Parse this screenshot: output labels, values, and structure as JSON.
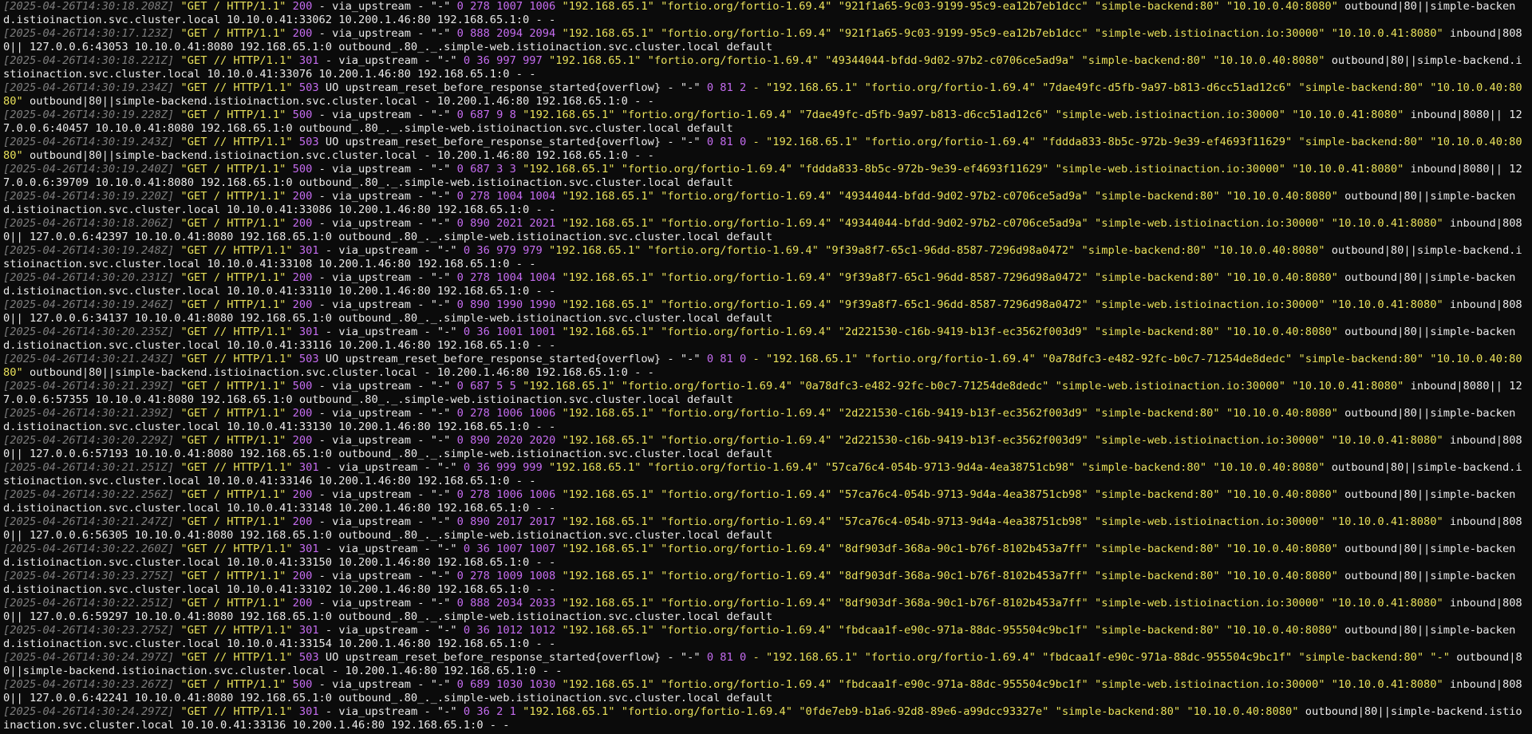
{
  "terminal": {
    "lines": [
      {
        "ts": "[2025-04-26T14:30:18.208Z]",
        "req": "\"GET / HTTP/1.1\"",
        "code": "200",
        "flags": "- via_upstream - \"-\"",
        "nums": "0 278 1007 1006",
        "quoted": "\"192.168.65.1\" \"fortio.org/fortio-1.69.4\" \"921f1a65-9c03-9199-95c9-ea12b7eb1dcc\" \"simple-backend:80\" \"10.10.0.40:8080\"",
        "tail": "outbound|80||simple-backend.istioinaction.svc.cluster.local 10.10.0.41:33062 10.200.1.46:80 192.168.65.1:0 - -"
      },
      {
        "ts": "[2025-04-26T14:30:17.123Z]",
        "req": "\"GET / HTTP/1.1\"",
        "code": "200",
        "flags": "- via_upstream - \"-\"",
        "nums": "0 888 2094 2094",
        "quoted": "\"192.168.65.1\" \"fortio.org/fortio-1.69.4\" \"921f1a65-9c03-9199-95c9-ea12b7eb1dcc\" \"simple-web.istioinaction.io:30000\" \"10.10.0.41:8080\"",
        "tail": "inbound|8080|| 127.0.0.6:43053 10.10.0.41:8080 192.168.65.1:0 outbound_.80_._.simple-web.istioinaction.svc.cluster.local default"
      },
      {
        "ts": "[2025-04-26T14:30:18.221Z]",
        "req": "\"GET // HTTP/1.1\"",
        "code": "301",
        "flags": "- via_upstream - \"-\"",
        "nums": "0 36 997 997",
        "quoted": "\"192.168.65.1\" \"fortio.org/fortio-1.69.4\" \"49344044-bfdd-9d02-97b2-c0706ce5ad9a\" \"simple-backend:80\" \"10.10.0.40:8080\"",
        "tail": "outbound|80||simple-backend.istioinaction.svc.cluster.local 10.10.0.41:33076 10.200.1.46:80 192.168.65.1:0 - -"
      },
      {
        "ts": "[2025-04-26T14:30:19.234Z]",
        "req": "\"GET // HTTP/1.1\"",
        "code": "503",
        "flags": "UO upstream_reset_before_response_started{overflow} - \"-\"",
        "nums": "0 81 2",
        "quoted": "- \"192.168.65.1\" \"fortio.org/fortio-1.69.4\" \"7dae49fc-d5fb-9a97-b813-d6cc51ad12c6\" \"simple-backend:80\" \"10.10.0.40:8080\"",
        "tail": "outbound|80||simple-backend.istioinaction.svc.cluster.local - 10.200.1.46:80 192.168.65.1:0 - -"
      },
      {
        "ts": "[2025-04-26T14:30:19.228Z]",
        "req": "\"GET / HTTP/1.1\"",
        "code": "500",
        "flags": "- via_upstream - \"-\"",
        "nums": "0 687 9 8",
        "quoted": "\"192.168.65.1\" \"fortio.org/fortio-1.69.4\" \"7dae49fc-d5fb-9a97-b813-d6cc51ad12c6\" \"simple-web.istioinaction.io:30000\" \"10.10.0.41:8080\"",
        "tail": "inbound|8080|| 127.0.0.6:40457 10.10.0.41:8080 192.168.65.1:0 outbound_.80_._.simple-web.istioinaction.svc.cluster.local default"
      },
      {
        "ts": "[2025-04-26T14:30:19.243Z]",
        "req": "\"GET // HTTP/1.1\"",
        "code": "503",
        "flags": "UO upstream_reset_before_response_started{overflow} - \"-\"",
        "nums": "0 81 0",
        "quoted": "- \"192.168.65.1\" \"fortio.org/fortio-1.69.4\" \"fddda833-8b5c-972b-9e39-ef4693f11629\" \"simple-backend:80\" \"10.10.0.40:8080\"",
        "tail": "outbound|80||simple-backend.istioinaction.svc.cluster.local - 10.200.1.46:80 192.168.65.1:0 - -"
      },
      {
        "ts": "[2025-04-26T14:30:19.240Z]",
        "req": "\"GET / HTTP/1.1\"",
        "code": "500",
        "flags": "- via_upstream - \"-\"",
        "nums": "0 687 3 3",
        "quoted": "\"192.168.65.1\" \"fortio.org/fortio-1.69.4\" \"fddda833-8b5c-972b-9e39-ef4693f11629\" \"simple-web.istioinaction.io:30000\" \"10.10.0.41:8080\"",
        "tail": "inbound|8080|| 127.0.0.6:39709 10.10.0.41:8080 192.168.65.1:0 outbound_.80_._.simple-web.istioinaction.svc.cluster.local default"
      },
      {
        "ts": "[2025-04-26T14:30:19.220Z]",
        "req": "\"GET / HTTP/1.1\"",
        "code": "200",
        "flags": "- via_upstream - \"-\"",
        "nums": "0 278 1004 1004",
        "quoted": "\"192.168.65.1\" \"fortio.org/fortio-1.69.4\" \"49344044-bfdd-9d02-97b2-c0706ce5ad9a\" \"simple-backend:80\" \"10.10.0.40:8080\"",
        "tail": "outbound|80||simple-backend.istioinaction.svc.cluster.local 10.10.0.41:33086 10.200.1.46:80 192.168.65.1:0 - -"
      },
      {
        "ts": "[2025-04-26T14:30:18.206Z]",
        "req": "\"GET / HTTP/1.1\"",
        "code": "200",
        "flags": "- via_upstream - \"-\"",
        "nums": "0 890 2021 2021",
        "quoted": "\"192.168.65.1\" \"fortio.org/fortio-1.69.4\" \"49344044-bfdd-9d02-97b2-c0706ce5ad9a\" \"simple-web.istioinaction.io:30000\" \"10.10.0.41:8080\"",
        "tail": "inbound|8080|| 127.0.0.6:42397 10.10.0.41:8080 192.168.65.1:0 outbound_.80_._.simple-web.istioinaction.svc.cluster.local default"
      },
      {
        "ts": "[2025-04-26T14:30:19.248Z]",
        "req": "\"GET // HTTP/1.1\"",
        "code": "301",
        "flags": "- via_upstream - \"-\"",
        "nums": "0 36 979 979",
        "quoted": "\"192.168.65.1\" \"fortio.org/fortio-1.69.4\" \"9f39a8f7-65c1-96dd-8587-7296d98a0472\" \"simple-backend:80\" \"10.10.0.40:8080\"",
        "tail": "outbound|80||simple-backend.istioinaction.svc.cluster.local 10.10.0.41:33108 10.200.1.46:80 192.168.65.1:0 - -"
      },
      {
        "ts": "[2025-04-26T14:30:20.231Z]",
        "req": "\"GET / HTTP/1.1\"",
        "code": "200",
        "flags": "- via_upstream - \"-\"",
        "nums": "0 278 1004 1004",
        "quoted": "\"192.168.65.1\" \"fortio.org/fortio-1.69.4\" \"9f39a8f7-65c1-96dd-8587-7296d98a0472\" \"simple-backend:80\" \"10.10.0.40:8080\"",
        "tail": "outbound|80||simple-backend.istioinaction.svc.cluster.local 10.10.0.41:33110 10.200.1.46:80 192.168.65.1:0 - -"
      },
      {
        "ts": "[2025-04-26T14:30:19.246Z]",
        "req": "\"GET / HTTP/1.1\"",
        "code": "200",
        "flags": "- via_upstream - \"-\"",
        "nums": "0 890 1990 1990",
        "quoted": "\"192.168.65.1\" \"fortio.org/fortio-1.69.4\" \"9f39a8f7-65c1-96dd-8587-7296d98a0472\" \"simple-web.istioinaction.io:30000\" \"10.10.0.41:8080\"",
        "tail": "inbound|8080|| 127.0.0.6:34137 10.10.0.41:8080 192.168.65.1:0 outbound_.80_._.simple-web.istioinaction.svc.cluster.local default"
      },
      {
        "ts": "[2025-04-26T14:30:20.235Z]",
        "req": "\"GET // HTTP/1.1\"",
        "code": "301",
        "flags": "- via_upstream - \"-\"",
        "nums": "0 36 1001 1001",
        "quoted": "\"192.168.65.1\" \"fortio.org/fortio-1.69.4\" \"2d221530-c16b-9419-b13f-ec3562f003d9\" \"simple-backend:80\" \"10.10.0.40:8080\"",
        "tail": "outbound|80||simple-backend.istioinaction.svc.cluster.local 10.10.0.41:33116 10.200.1.46:80 192.168.65.1:0 - -"
      },
      {
        "ts": "[2025-04-26T14:30:21.243Z]",
        "req": "\"GET // HTTP/1.1\"",
        "code": "503",
        "flags": "UO upstream_reset_before_response_started{overflow} - \"-\"",
        "nums": "0 81 0",
        "quoted": "- \"192.168.65.1\" \"fortio.org/fortio-1.69.4\" \"0a78dfc3-e482-92fc-b0c7-71254de8dedc\" \"simple-backend:80\" \"10.10.0.40:8080\"",
        "tail": "outbound|80||simple-backend.istioinaction.svc.cluster.local - 10.200.1.46:80 192.168.65.1:0 - -"
      },
      {
        "ts": "[2025-04-26T14:30:21.239Z]",
        "req": "\"GET / HTTP/1.1\"",
        "code": "500",
        "flags": "- via_upstream - \"-\"",
        "nums": "0 687 5 5",
        "quoted": "\"192.168.65.1\" \"fortio.org/fortio-1.69.4\" \"0a78dfc3-e482-92fc-b0c7-71254de8dedc\" \"simple-web.istioinaction.io:30000\" \"10.10.0.41:8080\"",
        "tail": "inbound|8080|| 127.0.0.6:57355 10.10.0.41:8080 192.168.65.1:0 outbound_.80_._.simple-web.istioinaction.svc.cluster.local default"
      },
      {
        "ts": "[2025-04-26T14:30:21.239Z]",
        "req": "\"GET / HTTP/1.1\"",
        "code": "200",
        "flags": "- via_upstream - \"-\"",
        "nums": "0 278 1006 1006",
        "quoted": "\"192.168.65.1\" \"fortio.org/fortio-1.69.4\" \"2d221530-c16b-9419-b13f-ec3562f003d9\" \"simple-backend:80\" \"10.10.0.40:8080\"",
        "tail": "outbound|80||simple-backend.istioinaction.svc.cluster.local 10.10.0.41:33130 10.200.1.46:80 192.168.65.1:0 - -"
      },
      {
        "ts": "[2025-04-26T14:30:20.229Z]",
        "req": "\"GET / HTTP/1.1\"",
        "code": "200",
        "flags": "- via_upstream - \"-\"",
        "nums": "0 890 2020 2020",
        "quoted": "\"192.168.65.1\" \"fortio.org/fortio-1.69.4\" \"2d221530-c16b-9419-b13f-ec3562f003d9\" \"simple-web.istioinaction.io:30000\" \"10.10.0.41:8080\"",
        "tail": "inbound|8080|| 127.0.0.6:57193 10.10.0.41:8080 192.168.65.1:0 outbound_.80_._.simple-web.istioinaction.svc.cluster.local default"
      },
      {
        "ts": "[2025-04-26T14:30:21.251Z]",
        "req": "\"GET // HTTP/1.1\"",
        "code": "301",
        "flags": "- via_upstream - \"-\"",
        "nums": "0 36 999 999",
        "quoted": "\"192.168.65.1\" \"fortio.org/fortio-1.69.4\" \"57ca76c4-054b-9713-9d4a-4ea38751cb98\" \"simple-backend:80\" \"10.10.0.40:8080\"",
        "tail": "outbound|80||simple-backend.istioinaction.svc.cluster.local 10.10.0.41:33146 10.200.1.46:80 192.168.65.1:0 - -"
      },
      {
        "ts": "[2025-04-26T14:30:22.256Z]",
        "req": "\"GET / HTTP/1.1\"",
        "code": "200",
        "flags": "- via_upstream - \"-\"",
        "nums": "0 278 1006 1006",
        "quoted": "\"192.168.65.1\" \"fortio.org/fortio-1.69.4\" \"57ca76c4-054b-9713-9d4a-4ea38751cb98\" \"simple-backend:80\" \"10.10.0.40:8080\"",
        "tail": "outbound|80||simple-backend.istioinaction.svc.cluster.local 10.10.0.41:33148 10.200.1.46:80 192.168.65.1:0 - -"
      },
      {
        "ts": "[2025-04-26T14:30:21.247Z]",
        "req": "\"GET / HTTP/1.1\"",
        "code": "200",
        "flags": "- via_upstream - \"-\"",
        "nums": "0 890 2017 2017",
        "quoted": "\"192.168.65.1\" \"fortio.org/fortio-1.69.4\" \"57ca76c4-054b-9713-9d4a-4ea38751cb98\" \"simple-web.istioinaction.io:30000\" \"10.10.0.41:8080\"",
        "tail": "inbound|8080|| 127.0.0.6:56305 10.10.0.41:8080 192.168.65.1:0 outbound_.80_._.simple-web.istioinaction.svc.cluster.local default"
      },
      {
        "ts": "[2025-04-26T14:30:22.260Z]",
        "req": "\"GET // HTTP/1.1\"",
        "code": "301",
        "flags": "- via_upstream - \"-\"",
        "nums": "0 36 1007 1007",
        "quoted": "\"192.168.65.1\" \"fortio.org/fortio-1.69.4\" \"8df903df-368a-90c1-b76f-8102b453a7ff\" \"simple-backend:80\" \"10.10.0.40:8080\"",
        "tail": "outbound|80||simple-backend.istioinaction.svc.cluster.local 10.10.0.41:33150 10.200.1.46:80 192.168.65.1:0 - -"
      },
      {
        "ts": "[2025-04-26T14:30:23.275Z]",
        "req": "\"GET / HTTP/1.1\"",
        "code": "200",
        "flags": "- via_upstream - \"-\"",
        "nums": "0 278 1009 1008",
        "quoted": "\"192.168.65.1\" \"fortio.org/fortio-1.69.4\" \"8df903df-368a-90c1-b76f-8102b453a7ff\" \"simple-backend:80\" \"10.10.0.40:8080\"",
        "tail": "outbound|80||simple-backend.istioinaction.svc.cluster.local 10.10.0.41:33102 10.200.1.46:80 192.168.65.1:0 - -"
      },
      {
        "ts": "[2025-04-26T14:30:22.251Z]",
        "req": "\"GET / HTTP/1.1\"",
        "code": "200",
        "flags": "- via_upstream - \"-\"",
        "nums": "0 888 2034 2033",
        "quoted": "\"192.168.65.1\" \"fortio.org/fortio-1.69.4\" \"8df903df-368a-90c1-b76f-8102b453a7ff\" \"simple-web.istioinaction.io:30000\" \"10.10.0.41:8080\"",
        "tail": "inbound|8080|| 127.0.0.6:59297 10.10.0.41:8080 192.168.65.1:0 outbound_.80_._.simple-web.istioinaction.svc.cluster.local default"
      },
      {
        "ts": "[2025-04-26T14:30:23.275Z]",
        "req": "\"GET // HTTP/1.1\"",
        "code": "301",
        "flags": "- via_upstream - \"-\"",
        "nums": "0 36 1012 1012",
        "quoted": "\"192.168.65.1\" \"fortio.org/fortio-1.69.4\" \"fbdcaa1f-e90c-971a-88dc-955504c9bc1f\" \"simple-backend:80\" \"10.10.0.40:8080\"",
        "tail": "outbound|80||simple-backend.istioinaction.svc.cluster.local 10.10.0.41:33154 10.200.1.46:80 192.168.65.1:0 - -"
      },
      {
        "ts": "[2025-04-26T14:30:24.297Z]",
        "req": "\"GET // HTTP/1.1\"",
        "code": "503",
        "flags": "UO upstream_reset_before_response_started{overflow} - \"-\"",
        "nums": "0 81 0",
        "quoted": "- \"192.168.65.1\" \"fortio.org/fortio-1.69.4\" \"fbdcaa1f-e90c-971a-88dc-955504c9bc1f\" \"simple-backend:80\" \"-\"",
        "tail": "outbound|80||simple-backend.istioinaction.svc.cluster.local - 10.200.1.46:80 192.168.65.1:0 - -"
      },
      {
        "ts": "[2025-04-26T14:30:23.267Z]",
        "req": "\"GET / HTTP/1.1\"",
        "code": "500",
        "flags": "- via_upstream - \"-\"",
        "nums": "0 689 1030 1030",
        "quoted": "\"192.168.65.1\" \"fortio.org/fortio-1.69.4\" \"fbdcaa1f-e90c-971a-88dc-955504c9bc1f\" \"simple-web.istioinaction.io:30000\" \"10.10.0.41:8080\"",
        "tail": "inbound|8080|| 127.0.0.6:42241 10.10.0.41:8080 192.168.65.1:0 outbound_.80_._.simple-web.istioinaction.svc.cluster.local default"
      },
      {
        "ts": "[2025-04-26T14:30:24.297Z]",
        "req": "\"GET // HTTP/1.1\"",
        "code": "301",
        "flags": "- via_upstream - \"-\"",
        "nums": "0 36 2 1",
        "quoted": "\"192.168.65.1\" \"fortio.org/fortio-1.69.4\" \"0fde7eb9-b1a6-92d8-89e6-a99dcc93327e\" \"simple-backend:80\" \"10.10.0.40:8080\"",
        "tail": "outbound|80||simple-backend.istioinaction.svc.cluster.local 10.10.0.41:33136 10.200.1.46:80 192.168.65.1:0 - -"
      }
    ]
  }
}
